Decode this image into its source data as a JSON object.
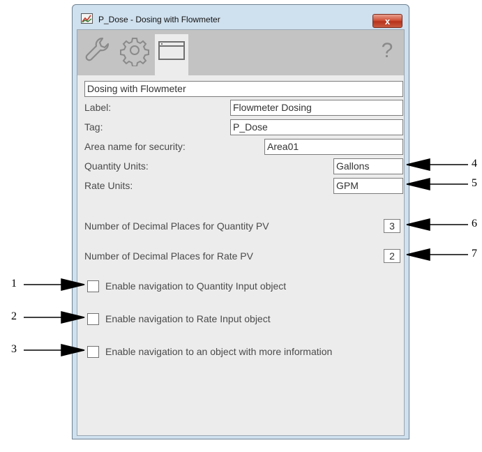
{
  "window": {
    "title": "P_Dose - Dosing with Flowmeter",
    "close_label": "x"
  },
  "toolbar": {
    "tabs": [
      {
        "name": "maintenance",
        "icon": "wrench-icon"
      },
      {
        "name": "engineering",
        "icon": "gear-icon"
      },
      {
        "name": "configuration",
        "icon": "window-icon",
        "active": true
      }
    ],
    "help_label": "?"
  },
  "form": {
    "description": "Dosing with Flowmeter",
    "label_caption": "Label:",
    "label_value": "Flowmeter Dosing",
    "tag_caption": "Tag:",
    "tag_value": "P_Dose",
    "area_caption": "Area name for security:",
    "area_value": "Area01",
    "quantity_units_caption": "Quantity Units:",
    "quantity_units_value": "Gallons",
    "rate_units_caption": "Rate Units:",
    "rate_units_value": "GPM",
    "decimal_qty_caption": "Number of Decimal Places for Quantity PV",
    "decimal_qty_value": "3",
    "decimal_rate_caption": "Number of Decimal Places for Rate PV",
    "decimal_rate_value": "2",
    "checkboxes": [
      {
        "label": "Enable navigation to Quantity Input object",
        "checked": false
      },
      {
        "label": "Enable navigation to Rate Input object",
        "checked": false
      },
      {
        "label": "Enable navigation to an object with more information",
        "checked": false
      }
    ]
  },
  "callouts": {
    "labels": [
      "1",
      "2",
      "3",
      "4",
      "5",
      "6",
      "7"
    ]
  },
  "colors": {
    "window_frame": "#cfe0ee",
    "panel_bg": "#ececec",
    "toolbar_bg": "#c3c3c3",
    "close_button": "#c8432a"
  }
}
